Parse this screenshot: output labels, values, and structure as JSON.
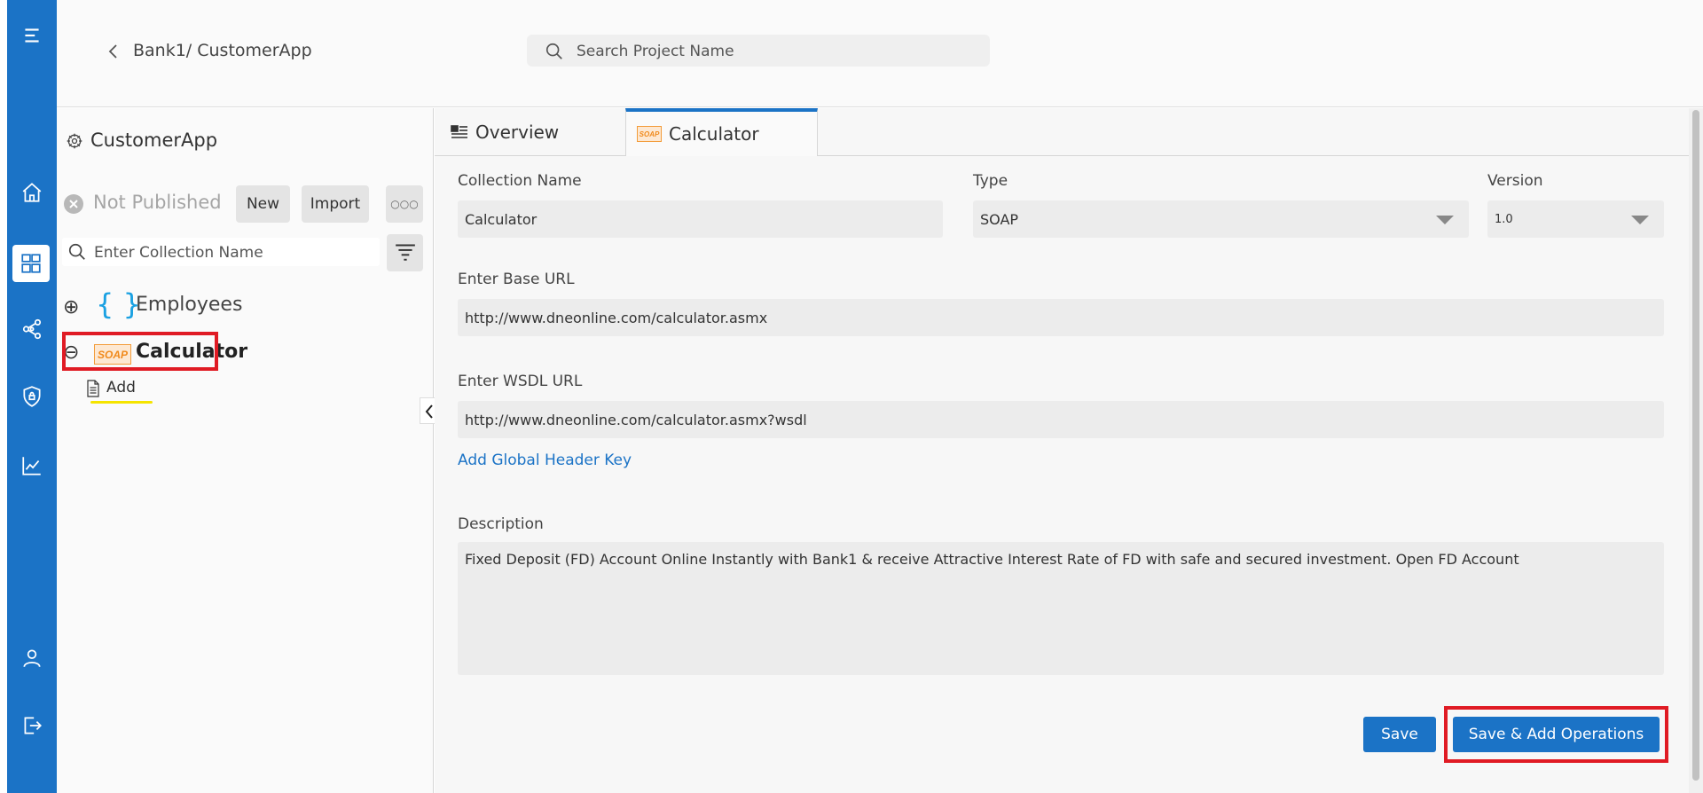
{
  "header": {
    "breadcrumb": "Bank1/ CustomerApp",
    "search_placeholder": "Search Project Name"
  },
  "rail": {
    "icons": [
      "menu-icon",
      "home-icon",
      "dashboard-icon",
      "share-network-icon",
      "shield-icon",
      "analytics-icon",
      "user-icon",
      "logout-icon"
    ]
  },
  "tree": {
    "project_name": "CustomerApp",
    "status": "Not Published",
    "new_label": "New",
    "import_label": "Import",
    "more_label": "○○○",
    "search_placeholder": "Enter Collection Name",
    "collections": [
      {
        "name": "Employees",
        "expand": "⊕",
        "type_icon": "{ }"
      },
      {
        "name": "Calculator",
        "expand": "⊖",
        "type_icon": "SOAP"
      }
    ],
    "operations": [
      {
        "name": "Add"
      }
    ]
  },
  "tabs": [
    {
      "label": "Overview",
      "active": false
    },
    {
      "label": "Calculator",
      "active": true,
      "badge": "SOAP"
    }
  ],
  "form": {
    "collection_name_label": "Collection Name",
    "collection_name_value": "Calculator",
    "type_label": "Type",
    "type_value": "SOAP",
    "version_label": "Version",
    "version_value": "1.0",
    "base_url_label": "Enter Base URL",
    "base_url_value": "http://www.dneonline.com/calculator.asmx",
    "wsdl_url_label": "Enter WSDL URL",
    "wsdl_url_value": "http://www.dneonline.com/calculator.asmx?wsdl",
    "add_header_link": "Add Global Header Key",
    "description_label": "Description",
    "description_value": "Fixed Deposit (FD) Account Online Instantly with  Bank1 & receive Attractive Interest Rate of FD with safe and secured investment. Open FD Account"
  },
  "actions": {
    "save_label": "Save",
    "save_add_label": "Save & Add Operations"
  },
  "colors": {
    "primary": "#1b73c6",
    "highlight": "#e01b24",
    "underline": "#f5e400",
    "soap_orange": "#f08a1c"
  }
}
